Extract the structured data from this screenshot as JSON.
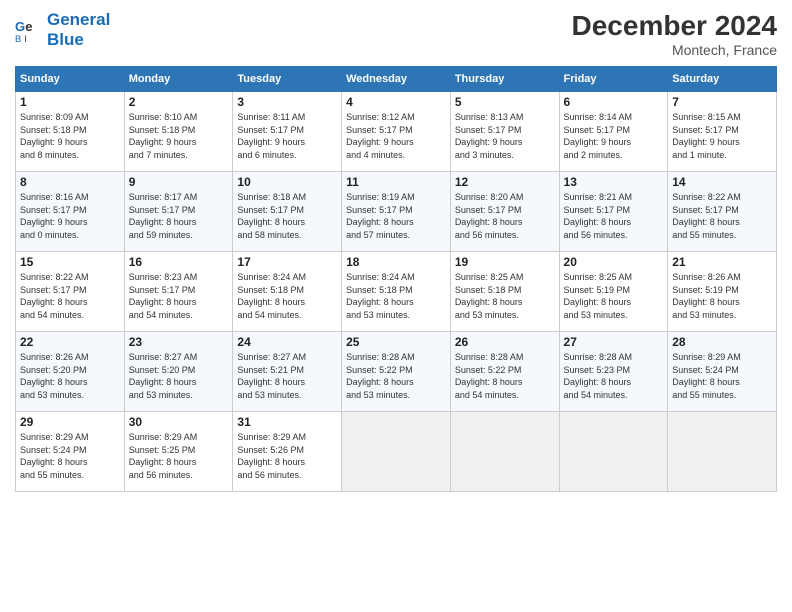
{
  "header": {
    "logo_line1": "General",
    "logo_line2": "Blue",
    "month_year": "December 2024",
    "location": "Montech, France"
  },
  "weekdays": [
    "Sunday",
    "Monday",
    "Tuesday",
    "Wednesday",
    "Thursday",
    "Friday",
    "Saturday"
  ],
  "weeks": [
    [
      {
        "day": "1",
        "info": "Sunrise: 8:09 AM\nSunset: 5:18 PM\nDaylight: 9 hours\nand 8 minutes."
      },
      {
        "day": "2",
        "info": "Sunrise: 8:10 AM\nSunset: 5:18 PM\nDaylight: 9 hours\nand 7 minutes."
      },
      {
        "day": "3",
        "info": "Sunrise: 8:11 AM\nSunset: 5:17 PM\nDaylight: 9 hours\nand 6 minutes."
      },
      {
        "day": "4",
        "info": "Sunrise: 8:12 AM\nSunset: 5:17 PM\nDaylight: 9 hours\nand 4 minutes."
      },
      {
        "day": "5",
        "info": "Sunrise: 8:13 AM\nSunset: 5:17 PM\nDaylight: 9 hours\nand 3 minutes."
      },
      {
        "day": "6",
        "info": "Sunrise: 8:14 AM\nSunset: 5:17 PM\nDaylight: 9 hours\nand 2 minutes."
      },
      {
        "day": "7",
        "info": "Sunrise: 8:15 AM\nSunset: 5:17 PM\nDaylight: 9 hours\nand 1 minute."
      }
    ],
    [
      {
        "day": "8",
        "info": "Sunrise: 8:16 AM\nSunset: 5:17 PM\nDaylight: 9 hours\nand 0 minutes."
      },
      {
        "day": "9",
        "info": "Sunrise: 8:17 AM\nSunset: 5:17 PM\nDaylight: 8 hours\nand 59 minutes."
      },
      {
        "day": "10",
        "info": "Sunrise: 8:18 AM\nSunset: 5:17 PM\nDaylight: 8 hours\nand 58 minutes."
      },
      {
        "day": "11",
        "info": "Sunrise: 8:19 AM\nSunset: 5:17 PM\nDaylight: 8 hours\nand 57 minutes."
      },
      {
        "day": "12",
        "info": "Sunrise: 8:20 AM\nSunset: 5:17 PM\nDaylight: 8 hours\nand 56 minutes."
      },
      {
        "day": "13",
        "info": "Sunrise: 8:21 AM\nSunset: 5:17 PM\nDaylight: 8 hours\nand 56 minutes."
      },
      {
        "day": "14",
        "info": "Sunrise: 8:22 AM\nSunset: 5:17 PM\nDaylight: 8 hours\nand 55 minutes."
      }
    ],
    [
      {
        "day": "15",
        "info": "Sunrise: 8:22 AM\nSunset: 5:17 PM\nDaylight: 8 hours\nand 54 minutes."
      },
      {
        "day": "16",
        "info": "Sunrise: 8:23 AM\nSunset: 5:17 PM\nDaylight: 8 hours\nand 54 minutes."
      },
      {
        "day": "17",
        "info": "Sunrise: 8:24 AM\nSunset: 5:18 PM\nDaylight: 8 hours\nand 54 minutes."
      },
      {
        "day": "18",
        "info": "Sunrise: 8:24 AM\nSunset: 5:18 PM\nDaylight: 8 hours\nand 53 minutes."
      },
      {
        "day": "19",
        "info": "Sunrise: 8:25 AM\nSunset: 5:18 PM\nDaylight: 8 hours\nand 53 minutes."
      },
      {
        "day": "20",
        "info": "Sunrise: 8:25 AM\nSunset: 5:19 PM\nDaylight: 8 hours\nand 53 minutes."
      },
      {
        "day": "21",
        "info": "Sunrise: 8:26 AM\nSunset: 5:19 PM\nDaylight: 8 hours\nand 53 minutes."
      }
    ],
    [
      {
        "day": "22",
        "info": "Sunrise: 8:26 AM\nSunset: 5:20 PM\nDaylight: 8 hours\nand 53 minutes."
      },
      {
        "day": "23",
        "info": "Sunrise: 8:27 AM\nSunset: 5:20 PM\nDaylight: 8 hours\nand 53 minutes."
      },
      {
        "day": "24",
        "info": "Sunrise: 8:27 AM\nSunset: 5:21 PM\nDaylight: 8 hours\nand 53 minutes."
      },
      {
        "day": "25",
        "info": "Sunrise: 8:28 AM\nSunset: 5:22 PM\nDaylight: 8 hours\nand 53 minutes."
      },
      {
        "day": "26",
        "info": "Sunrise: 8:28 AM\nSunset: 5:22 PM\nDaylight: 8 hours\nand 54 minutes."
      },
      {
        "day": "27",
        "info": "Sunrise: 8:28 AM\nSunset: 5:23 PM\nDaylight: 8 hours\nand 54 minutes."
      },
      {
        "day": "28",
        "info": "Sunrise: 8:29 AM\nSunset: 5:24 PM\nDaylight: 8 hours\nand 55 minutes."
      }
    ],
    [
      {
        "day": "29",
        "info": "Sunrise: 8:29 AM\nSunset: 5:24 PM\nDaylight: 8 hours\nand 55 minutes."
      },
      {
        "day": "30",
        "info": "Sunrise: 8:29 AM\nSunset: 5:25 PM\nDaylight: 8 hours\nand 56 minutes."
      },
      {
        "day": "31",
        "info": "Sunrise: 8:29 AM\nSunset: 5:26 PM\nDaylight: 8 hours\nand 56 minutes."
      },
      {
        "day": "",
        "info": ""
      },
      {
        "day": "",
        "info": ""
      },
      {
        "day": "",
        "info": ""
      },
      {
        "day": "",
        "info": ""
      }
    ]
  ]
}
